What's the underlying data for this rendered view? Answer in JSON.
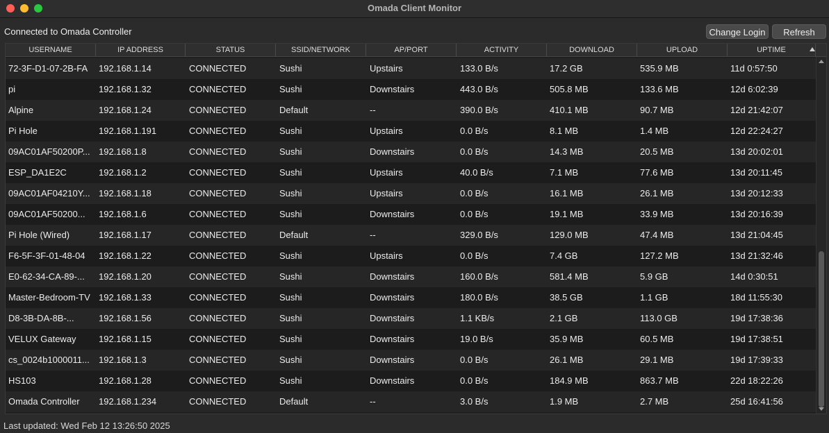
{
  "window": {
    "title": "Omada Client Monitor"
  },
  "toolbar": {
    "connection_status": "Connected to Omada Controller",
    "change_login_label": "Change Login",
    "refresh_label": "Refresh"
  },
  "table": {
    "sort_indicator": "chevron-up-icon",
    "columns": [
      "USERNAME",
      "IP ADDRESS",
      "STATUS",
      "SSID/NETWORK",
      "AP/PORT",
      "ACTIVITY",
      "DOWNLOAD",
      "UPLOAD",
      "UPTIME"
    ],
    "rows": [
      [
        "72-3F-D1-07-2B-FA",
        "192.168.1.14",
        "CONNECTED",
        "Sushi",
        "Upstairs",
        "133.0 B/s",
        "17.2 GB",
        "535.9 MB",
        "11d 0:57:50"
      ],
      [
        "pi",
        "192.168.1.32",
        "CONNECTED",
        "Sushi",
        "Downstairs",
        "443.0 B/s",
        "505.8 MB",
        "133.6 MB",
        "12d 6:02:39"
      ],
      [
        "Alpine",
        "192.168.1.24",
        "CONNECTED",
        "Default",
        "--",
        "390.0 B/s",
        "410.1 MB",
        "90.7 MB",
        "12d 21:42:07"
      ],
      [
        "Pi Hole",
        "192.168.1.191",
        "CONNECTED",
        "Sushi",
        "Upstairs",
        "0.0 B/s",
        "8.1 MB",
        "1.4 MB",
        "12d 22:24:27"
      ],
      [
        "09AC01AF50200P...",
        "192.168.1.8",
        "CONNECTED",
        "Sushi",
        "Downstairs",
        "0.0 B/s",
        "14.3 MB",
        "20.5 MB",
        "13d 20:02:01"
      ],
      [
        "ESP_DA1E2C",
        "192.168.1.2",
        "CONNECTED",
        "Sushi",
        "Upstairs",
        "40.0 B/s",
        "7.1 MB",
        "77.6 MB",
        "13d 20:11:45"
      ],
      [
        "09AC01AF04210Y...",
        "192.168.1.18",
        "CONNECTED",
        "Sushi",
        "Upstairs",
        "0.0 B/s",
        "16.1 MB",
        "26.1 MB",
        "13d 20:12:33"
      ],
      [
        "09AC01AF50200...",
        "192.168.1.6",
        "CONNECTED",
        "Sushi",
        "Downstairs",
        "0.0 B/s",
        "19.1 MB",
        "33.9 MB",
        "13d 20:16:39"
      ],
      [
        "Pi Hole (Wired)",
        "192.168.1.17",
        "CONNECTED",
        "Default",
        "--",
        "329.0 B/s",
        "129.0 MB",
        "47.4 MB",
        "13d 21:04:45"
      ],
      [
        "F6-5F-3F-01-48-04",
        "192.168.1.22",
        "CONNECTED",
        "Sushi",
        "Upstairs",
        "0.0 B/s",
        "7.4 GB",
        "127.2 MB",
        "13d 21:32:46"
      ],
      [
        "E0-62-34-CA-89-...",
        "192.168.1.20",
        "CONNECTED",
        "Sushi",
        "Downstairs",
        "160.0 B/s",
        "581.4 MB",
        "5.9 GB",
        "14d 0:30:51"
      ],
      [
        "Master-Bedroom-TV",
        "192.168.1.33",
        "CONNECTED",
        "Sushi",
        "Downstairs",
        "180.0 B/s",
        "38.5 GB",
        "1.1 GB",
        "18d 11:55:30"
      ],
      [
        "D8-3B-DA-8B-...",
        "192.168.1.56",
        "CONNECTED",
        "Sushi",
        "Downstairs",
        "1.1 KB/s",
        "2.1 GB",
        "113.0 GB",
        "19d 17:38:36"
      ],
      [
        "VELUX Gateway",
        "192.168.1.15",
        "CONNECTED",
        "Sushi",
        "Downstairs",
        "19.0 B/s",
        "35.9 MB",
        "60.5 MB",
        "19d 17:38:51"
      ],
      [
        "cs_0024b1000011...",
        "192.168.1.3",
        "CONNECTED",
        "Sushi",
        "Downstairs",
        "0.0 B/s",
        "26.1 MB",
        "29.1 MB",
        "19d 17:39:33"
      ],
      [
        "HS103",
        "192.168.1.28",
        "CONNECTED",
        "Sushi",
        "Downstairs",
        "0.0 B/s",
        "184.9 MB",
        "863.7 MB",
        "22d 18:22:26"
      ],
      [
        "Omada Controller",
        "192.168.1.234",
        "CONNECTED",
        "Default",
        "--",
        "3.0 B/s",
        "1.9 MB",
        "2.7 MB",
        "25d 16:41:56"
      ]
    ]
  },
  "footer": {
    "last_updated": "Last updated: Wed Feb 12 13:26:50 2025"
  }
}
